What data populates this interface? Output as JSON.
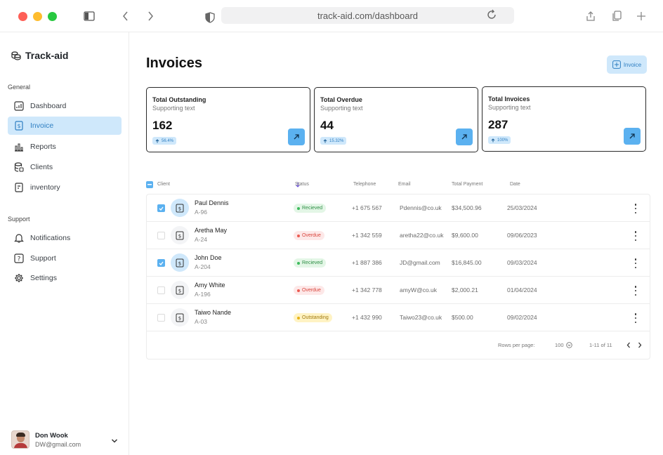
{
  "browser": {
    "url": "track-aid.com/dashboard"
  },
  "sidebar": {
    "brand": "Track-aid",
    "sections": {
      "general": "General",
      "support": "Support"
    },
    "general_items": [
      {
        "label": "Dashboard",
        "icon": "dashboard-icon",
        "active": false
      },
      {
        "label": "Invoice",
        "icon": "invoice-icon",
        "active": true
      },
      {
        "label": "Reports",
        "icon": "reports-icon",
        "active": false
      },
      {
        "label": "Clients",
        "icon": "clients-icon",
        "active": false
      },
      {
        "label": "inventory",
        "icon": "inventory-icon",
        "active": false
      }
    ],
    "support_items": [
      {
        "label": "Notifications",
        "icon": "bell-icon"
      },
      {
        "label": "Support",
        "icon": "help-icon"
      },
      {
        "label": "Settings",
        "icon": "gear-icon"
      }
    ],
    "user": {
      "name": "Don Wook",
      "email": "DW@gmail.com"
    }
  },
  "main": {
    "title": "Invoices",
    "new_button_label": "Invoice",
    "cards": [
      {
        "title": "Total Outstanding",
        "sub": "Supporting text",
        "value": "162",
        "badge": "56.4%"
      },
      {
        "title": "Total Overdue",
        "sub": "Supporting text",
        "value": "44",
        "badge": "15.32%"
      },
      {
        "title": "Total Invoices",
        "sub": "Supporting text",
        "value": "287",
        "badge": "100%"
      }
    ],
    "table": {
      "headers": {
        "client": "Client",
        "status": "Status",
        "telephone": "Telephone",
        "email": "Email",
        "total_payment": "Total Payment",
        "date": "Date"
      },
      "rows": [
        {
          "name": "Paul Dennis",
          "code": "A-96",
          "status": "Recieved",
          "status_kind": "received",
          "telephone": "+1 675 567",
          "email": "Pdennis@co.uk",
          "payment": "$34,500.96",
          "date": "25/03/2024",
          "checked": true
        },
        {
          "name": "Aretha May",
          "code": "A-24",
          "status": "Overdue",
          "status_kind": "overdue",
          "telephone": "+1 342 559",
          "email": "aretha22@co.uk",
          "payment": "$9,600.00",
          "date": "09/06/2023",
          "checked": false
        },
        {
          "name": "John Doe",
          "code": "A-204",
          "status": "Recieved",
          "status_kind": "received",
          "telephone": "+1 887 386",
          "email": "JD@gmail.com",
          "payment": "$16,845.00",
          "date": "09/03/2024",
          "checked": true
        },
        {
          "name": "Amy White",
          "code": "A-196",
          "status": "Overdue",
          "status_kind": "overdue",
          "telephone": "+1 342 778",
          "email": "amyW@co.uk",
          "payment": "$2,000.21",
          "date": "01/04/2024",
          "checked": false
        },
        {
          "name": "Taiwo Nande",
          "code": "A-03",
          "status": "Outstanding",
          "status_kind": "outstanding",
          "telephone": "+1 432 990",
          "email": "Taiwo23@co.uk",
          "payment": "$500.00",
          "date": "09/02/2024",
          "checked": false
        }
      ],
      "pagination": {
        "rows_per_page_label": "Rows per page:",
        "rows_per_page_value": "100",
        "range": "1-11 of 11"
      }
    }
  },
  "colors": {
    "accent": "#5bb1f0",
    "accent_light": "#cfe8fb",
    "accent_text": "#2f7fc2"
  }
}
